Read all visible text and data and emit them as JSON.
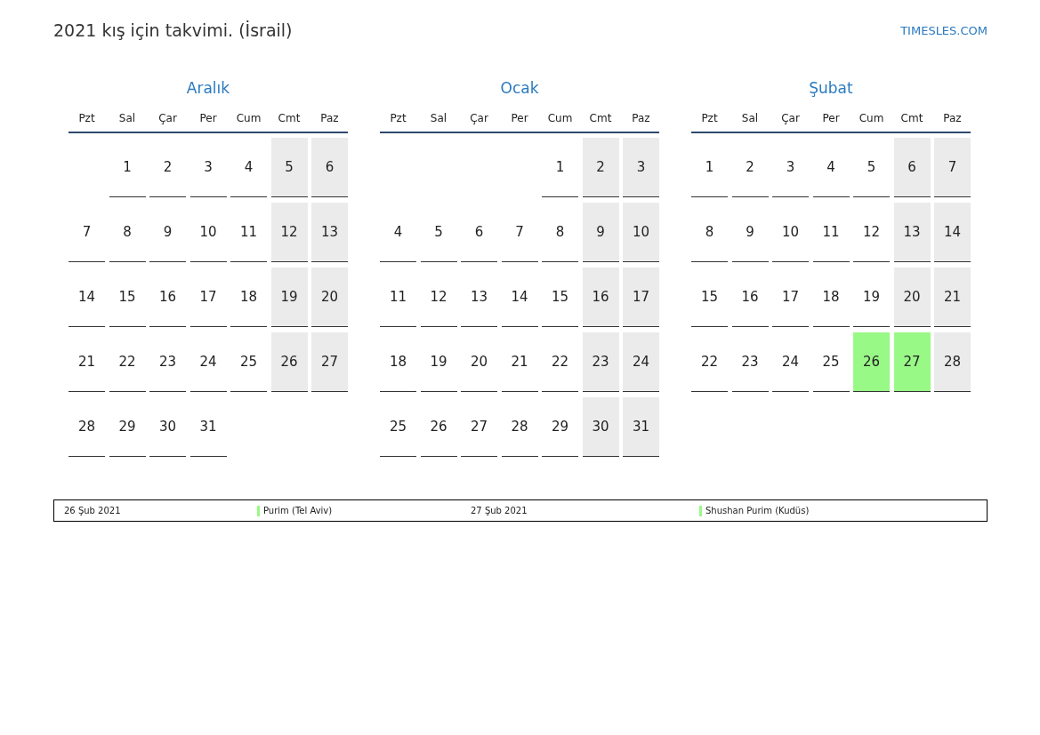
{
  "title": "2021 kış için takvimi. (İsrail)",
  "site": "TIMESLES.COM",
  "months": [
    {
      "name": "Aralık",
      "weekdays": [
        {
          "label": "Pzt",
          "weekend": false
        },
        {
          "label": "Sal",
          "weekend": false
        },
        {
          "label": "Çar",
          "weekend": false
        },
        {
          "label": "Per",
          "weekend": false
        },
        {
          "label": "Cum",
          "weekend": false
        },
        {
          "label": "Cmt",
          "weekend": true
        },
        {
          "label": "Paz",
          "weekend": true
        }
      ],
      "weeks": [
        {
          "kind": "leading",
          "days": [
            {
              "day": "1"
            },
            {
              "day": "2"
            },
            {
              "day": "3"
            },
            {
              "day": "4"
            },
            {
              "day": "5"
            },
            {
              "day": "6"
            }
          ]
        },
        {
          "days": [
            {
              "day": "7"
            },
            {
              "day": "8"
            },
            {
              "day": "9"
            },
            {
              "day": "10"
            },
            {
              "day": "11"
            },
            {
              "day": "12"
            },
            {
              "day": "13"
            }
          ]
        },
        {
          "days": [
            {
              "day": "14"
            },
            {
              "day": "15"
            },
            {
              "day": "16"
            },
            {
              "day": "17"
            },
            {
              "day": "18"
            },
            {
              "day": "19"
            },
            {
              "day": "20"
            }
          ]
        },
        {
          "days": [
            {
              "day": "21"
            },
            {
              "day": "22"
            },
            {
              "day": "23"
            },
            {
              "day": "24"
            },
            {
              "day": "25"
            },
            {
              "day": "26"
            },
            {
              "day": "27"
            }
          ]
        },
        {
          "kind": "trailing",
          "days": [
            {
              "day": "28"
            },
            {
              "day": "29"
            },
            {
              "day": "30"
            },
            {
              "day": "31"
            }
          ]
        }
      ]
    },
    {
      "name": "Ocak",
      "weekdays": [
        {
          "label": "Pzt",
          "weekend": false
        },
        {
          "label": "Sal",
          "weekend": false
        },
        {
          "label": "Çar",
          "weekend": false
        },
        {
          "label": "Per",
          "weekend": false
        },
        {
          "label": "Cum",
          "weekend": false
        },
        {
          "label": "Cmt",
          "weekend": true
        },
        {
          "label": "Paz",
          "weekend": true
        }
      ],
      "weeks": [
        {
          "kind": "leading",
          "days": [
            {
              "day": "1"
            },
            {
              "day": "2"
            },
            {
              "day": "3"
            }
          ]
        },
        {
          "days": [
            {
              "day": "4"
            },
            {
              "day": "5"
            },
            {
              "day": "6"
            },
            {
              "day": "7"
            },
            {
              "day": "8"
            },
            {
              "day": "9"
            },
            {
              "day": "10"
            }
          ]
        },
        {
          "days": [
            {
              "day": "11"
            },
            {
              "day": "12"
            },
            {
              "day": "13"
            },
            {
              "day": "14"
            },
            {
              "day": "15"
            },
            {
              "day": "16"
            },
            {
              "day": "17"
            }
          ]
        },
        {
          "days": [
            {
              "day": "18"
            },
            {
              "day": "19"
            },
            {
              "day": "20"
            },
            {
              "day": "21"
            },
            {
              "day": "22"
            },
            {
              "day": "23"
            },
            {
              "day": "24"
            }
          ]
        },
        {
          "days": [
            {
              "day": "25"
            },
            {
              "day": "26"
            },
            {
              "day": "27"
            },
            {
              "day": "28"
            },
            {
              "day": "29"
            },
            {
              "day": "30"
            },
            {
              "day": "31"
            }
          ]
        }
      ]
    },
    {
      "name": "Şubat",
      "weekdays": [
        {
          "label": "Pzt",
          "weekend": false
        },
        {
          "label": "Sal",
          "weekend": false
        },
        {
          "label": "Çar",
          "weekend": false
        },
        {
          "label": "Per",
          "weekend": false
        },
        {
          "label": "Cum",
          "weekend": false
        },
        {
          "label": "Cmt",
          "weekend": true
        },
        {
          "label": "Paz",
          "weekend": true
        }
      ],
      "weeks": [
        {
          "days": [
            {
              "day": "1"
            },
            {
              "day": "2"
            },
            {
              "day": "3"
            },
            {
              "day": "4"
            },
            {
              "day": "5"
            },
            {
              "day": "6"
            },
            {
              "day": "7"
            }
          ]
        },
        {
          "days": [
            {
              "day": "8"
            },
            {
              "day": "9"
            },
            {
              "day": "10"
            },
            {
              "day": "11"
            },
            {
              "day": "12"
            },
            {
              "day": "13"
            },
            {
              "day": "14"
            }
          ]
        },
        {
          "days": [
            {
              "day": "15"
            },
            {
              "day": "16"
            },
            {
              "day": "17"
            },
            {
              "day": "18"
            },
            {
              "day": "19"
            },
            {
              "day": "20"
            },
            {
              "day": "21"
            }
          ]
        },
        {
          "days": [
            {
              "day": "22"
            },
            {
              "day": "23"
            },
            {
              "day": "24"
            },
            {
              "day": "25"
            },
            {
              "day": "26",
              "color": "#99f987"
            },
            {
              "day": "27",
              "color": "#99f987"
            },
            {
              "day": "28"
            }
          ]
        }
      ]
    }
  ],
  "holidays": [
    {
      "date": "26 Şub 2021",
      "name": "Purim (Tel Aviv)",
      "color": "#99f987"
    },
    {
      "date": "27 Şub 2021",
      "name": "Shushan Purim (Kudüs)",
      "color": "#99f987"
    }
  ]
}
